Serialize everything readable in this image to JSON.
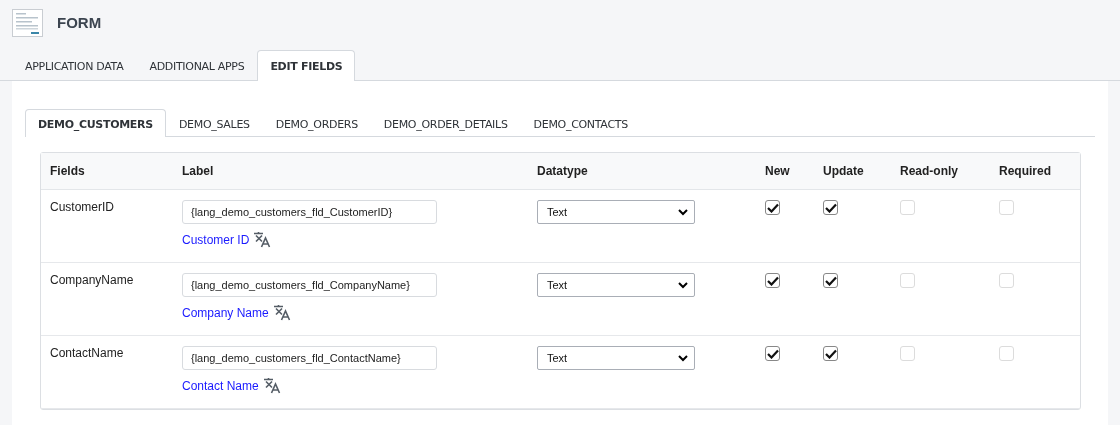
{
  "header": {
    "title": "FORM"
  },
  "tabs": [
    {
      "label": "APPLICATION DATA",
      "selected": false
    },
    {
      "label": "ADDITIONAL APPS",
      "selected": false
    },
    {
      "label": "EDIT FIELDS",
      "selected": true
    }
  ],
  "subtabs": [
    {
      "label": "DEMO_CUSTOMERS",
      "selected": true
    },
    {
      "label": "DEMO_SALES",
      "selected": false
    },
    {
      "label": "DEMO_ORDERS",
      "selected": false
    },
    {
      "label": "DEMO_ORDER_DETAILS",
      "selected": false
    },
    {
      "label": "DEMO_CONTACTS",
      "selected": false
    }
  ],
  "table": {
    "columns": [
      "Fields",
      "Label",
      "Datatype",
      "New",
      "Update",
      "Read-only",
      "Required"
    ],
    "rows": [
      {
        "field": "CustomerID",
        "label_value": "{lang_demo_customers_fld_CustomerID}",
        "label_preview": "Customer ID",
        "datatype": "Text",
        "checks": [
          {
            "checked": true,
            "disabled": false
          },
          {
            "checked": true,
            "disabled": false
          },
          {
            "checked": false,
            "disabled": true
          },
          {
            "checked": false,
            "disabled": true
          }
        ]
      },
      {
        "field": "CompanyName",
        "label_value": "{lang_demo_customers_fld_CompanyName}",
        "label_preview": "Company Name",
        "datatype": "Text",
        "checks": [
          {
            "checked": true,
            "disabled": false
          },
          {
            "checked": true,
            "disabled": false
          },
          {
            "checked": false,
            "disabled": true
          },
          {
            "checked": false,
            "disabled": true
          }
        ]
      },
      {
        "field": "ContactName",
        "label_value": "{lang_demo_customers_fld_ContactName}",
        "label_preview": "Contact Name",
        "datatype": "Text",
        "checks": [
          {
            "checked": true,
            "disabled": false
          },
          {
            "checked": true,
            "disabled": false
          },
          {
            "checked": false,
            "disabled": true
          },
          {
            "checked": false,
            "disabled": true
          }
        ]
      }
    ]
  }
}
